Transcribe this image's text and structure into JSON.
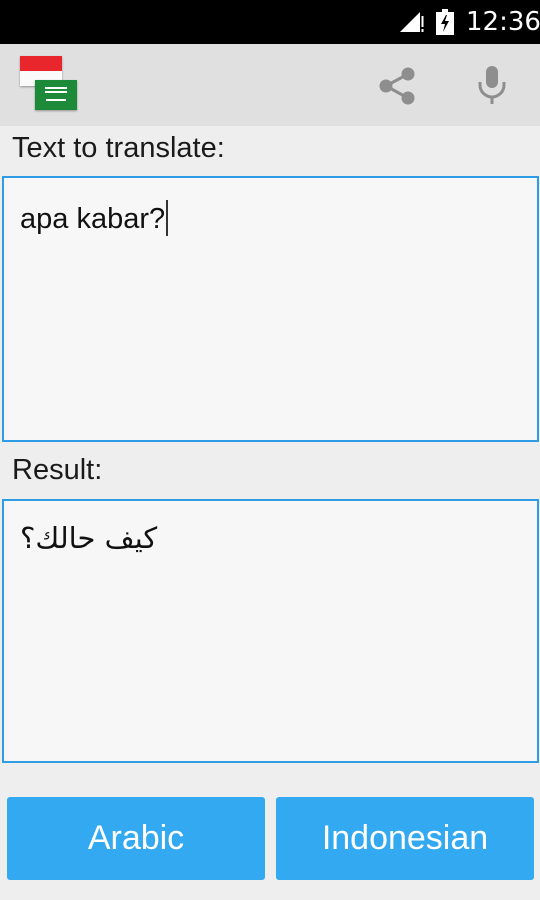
{
  "status_bar": {
    "time": "12:36"
  },
  "action_bar": {
    "source_flag": "indonesia-flag",
    "target_flag": "saudi-arabia-flag",
    "share_icon": "share-icon",
    "mic_icon": "microphone-icon"
  },
  "input": {
    "label": "Text to translate:",
    "value": "apa kabar?"
  },
  "result": {
    "label": "Result:",
    "value": "كيف حالك؟"
  },
  "buttons": {
    "arabic": "Arabic",
    "indonesian": "Indonesian"
  },
  "colors": {
    "accent": "#2f9de6",
    "button": "#33a9f1",
    "action_bar": "#e0e0e0",
    "background": "#eeeeee"
  }
}
